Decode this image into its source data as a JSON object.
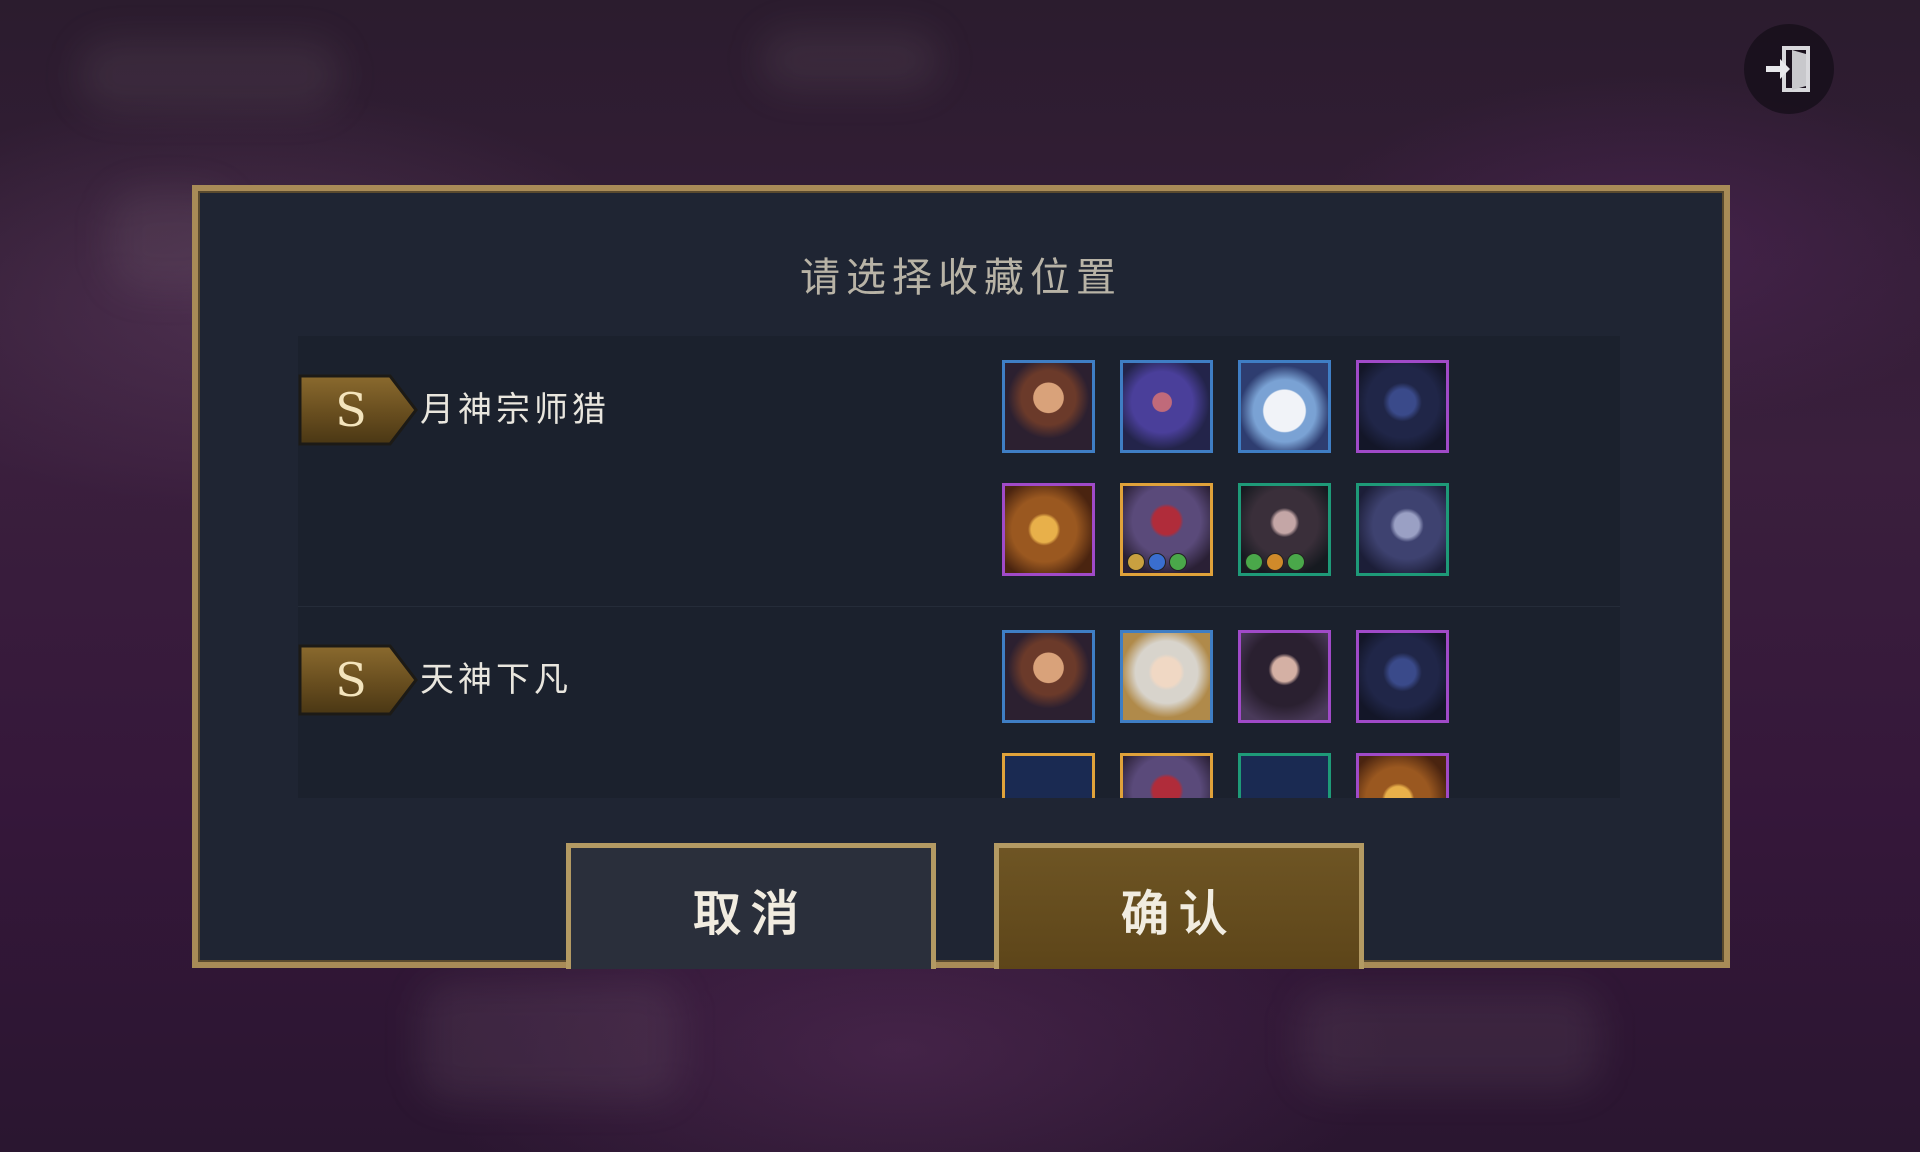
{
  "dialog": {
    "title": "请选择收藏位置",
    "cancel_label": "取消",
    "confirm_label": "确认"
  },
  "colors": {
    "frame_gold": "#a88b57",
    "tier_1_border": "#3f7ec4",
    "tier_2_border": "#1e9a78",
    "tier_4_border": "#a04ac8",
    "tier_5_border": "#e0a23a",
    "empty_slot": "#1a2a52"
  },
  "compositions": [
    {
      "rank": "S",
      "name": "月神宗师猎",
      "champions": [
        {
          "portrait": "gold-armored-heroine-portrait",
          "tier_color": "#3f7ec4"
        },
        {
          "portrait": "blue-haired-swordsman-portrait",
          "tier_color": "#3f7ec4"
        },
        {
          "portrait": "blue-cat-portrait",
          "tier_color": "#3f7ec4"
        },
        {
          "portrait": "dark-masked-ninja-portrait",
          "tier_color": "#a04ac8"
        },
        {
          "portrait": "golden-dragon-portrait",
          "tier_color": "#a04ac8"
        },
        {
          "portrait": "crimson-demon-portrait",
          "tier_color": "#e0a23a",
          "items": [
            "#c9a040",
            "#3a6ecf",
            "#4aa84a"
          ]
        },
        {
          "portrait": "dark-haired-markswoman-portrait",
          "tier_color": "#1e9a78",
          "items": [
            "#4aa84a",
            "#d08a2a",
            "#4aa84a"
          ]
        },
        {
          "portrait": "pale-assassin-portrait",
          "tier_color": "#1e9a78"
        }
      ]
    },
    {
      "rank": "S",
      "name": "天神下凡",
      "champions": [
        {
          "portrait": "gold-armored-heroine-portrait",
          "tier_color": "#3f7ec4"
        },
        {
          "portrait": "silver-haired-lady-portrait",
          "tier_color": "#3f7ec4"
        },
        {
          "portrait": "dark-sorceress-portrait",
          "tier_color": "#a04ac8"
        },
        {
          "portrait": "dark-masked-ninja-portrait",
          "tier_color": "#a04ac8"
        },
        {
          "portrait": "empty-slot",
          "tier_color": "#e0a23a"
        },
        {
          "portrait": "crimson-demon-portrait",
          "tier_color": "#e0a23a"
        },
        {
          "portrait": "empty-slot",
          "tier_color": "#1e9a78"
        },
        {
          "portrait": "golden-dragon-portrait",
          "tier_color": "#a04ac8"
        }
      ]
    }
  ]
}
